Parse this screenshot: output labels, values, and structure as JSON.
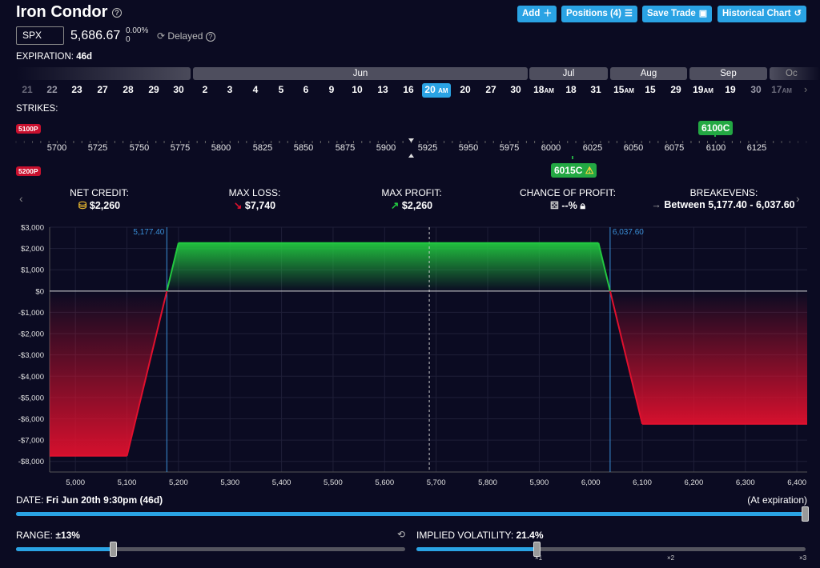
{
  "header": {
    "title": "Iron Condor",
    "buttons": {
      "add": "Add",
      "positions": "Positions (4)",
      "save": "Save Trade",
      "historical": "Historical Chart"
    }
  },
  "ticker": {
    "symbol": "SPX",
    "price": "5,686.67",
    "change_pct": "0.00%",
    "change_abs": "0",
    "status": "Delayed"
  },
  "expiration": {
    "label": "EXPIRATION:",
    "value": "46d"
  },
  "calendar": {
    "months": [
      "Jun",
      "Jul",
      "Aug",
      "Sep",
      "Oc"
    ],
    "days": [
      "21",
      "22",
      "23",
      "27",
      "28",
      "29",
      "30",
      "2",
      "3",
      "4",
      "5",
      "6",
      "9",
      "10",
      "13",
      "16",
      "20",
      "20",
      "27",
      "30",
      "18",
      "18",
      "31",
      "15",
      "15",
      "29",
      "19",
      "19",
      "30",
      "17"
    ],
    "day_suffixes": {
      "am": "AM"
    }
  },
  "strikes": {
    "label": "STRIKES:",
    "badges": {
      "put_long": "5100P",
      "put_short": "5200P",
      "call_long": "6100C",
      "call_short": "6015C"
    },
    "ticks": [
      "5700",
      "5725",
      "5750",
      "5775",
      "5800",
      "5825",
      "5850",
      "5875",
      "5900",
      "5925",
      "5950",
      "5975",
      "6000",
      "6025",
      "6050",
      "6075",
      "6100",
      "6125"
    ]
  },
  "stats": {
    "net_credit": {
      "label": "NET CREDIT:",
      "value": "$2,260"
    },
    "max_loss": {
      "label": "MAX LOSS:",
      "value": "$7,740"
    },
    "max_profit": {
      "label": "MAX PROFIT:",
      "value": "$2,260"
    },
    "chance": {
      "label": "CHANCE OF PROFIT:",
      "value": "--%"
    },
    "breakevens": {
      "label": "BREAKEVENS:",
      "value": "Between 5,177.40 - 6,037.60"
    }
  },
  "chart_data": {
    "type": "area",
    "xlabel": "",
    "ylabel": "",
    "x_ticks": [
      "5,000",
      "5,100",
      "5,200",
      "5,300",
      "5,400",
      "5,500",
      "5,600",
      "5,700",
      "5,800",
      "5,900",
      "6,000",
      "6,100",
      "6,200",
      "6,300",
      "6,400"
    ],
    "y_ticks": [
      "$3,000",
      "$2,000",
      "$1,000",
      "$0",
      "-$1,000",
      "-$2,000",
      "-$3,000",
      "-$4,000",
      "-$5,000",
      "-$6,000",
      "-$7,000",
      "-$8,000"
    ],
    "xlim": [
      4950,
      6420
    ],
    "ylim": [
      -8500,
      3000
    ],
    "series": [
      {
        "values": [
          [
            4950,
            -7740
          ],
          [
            5100,
            -7740
          ],
          [
            5200,
            2260
          ],
          [
            6015,
            2260
          ],
          [
            6100,
            -6240
          ],
          [
            6420,
            -6240
          ]
        ]
      }
    ],
    "breakeven_labels": [
      "5,177.40",
      "6,037.60"
    ],
    "breakevens": [
      5177.4,
      6037.6
    ],
    "current_price": 5686.67,
    "colors": {
      "profit": "#22c840",
      "loss": "#e0102e",
      "breakeven": "#3a8fd8"
    }
  },
  "date_slider": {
    "label": "DATE:",
    "value": "Fri Jun 20th 9:30pm (46d)",
    "right": "(At expiration)",
    "fraction": 1.0
  },
  "range_slider": {
    "label": "RANGE:",
    "value": "±13%",
    "fraction": 0.25
  },
  "iv_slider": {
    "label": "IMPLIED VOLATILITY:",
    "value": "21.4%",
    "ticks": [
      "×1",
      "×2",
      "×3"
    ],
    "fraction": 0.31
  }
}
